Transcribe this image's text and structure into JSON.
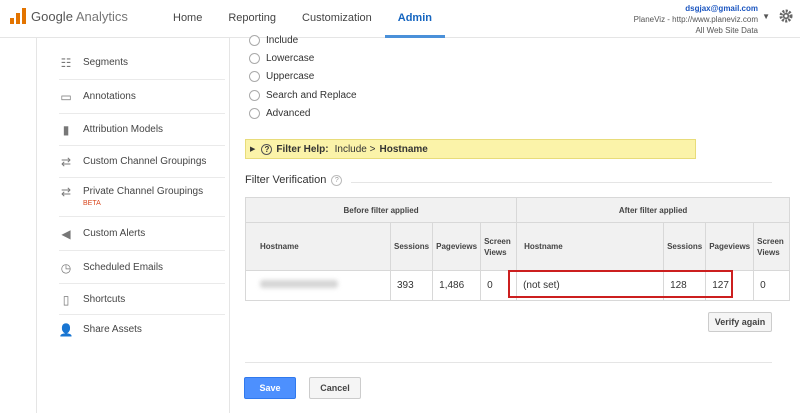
{
  "header": {
    "logo_google": "Google",
    "logo_analytics": "Analytics",
    "nav": [
      "Home",
      "Reporting",
      "Customization",
      "Admin"
    ],
    "active_nav": "Admin",
    "account_email": "dsgjax@gmail.com",
    "account_property": "PlaneViz - http://www.planeviz.com",
    "account_view": "All Web Site Data"
  },
  "sidebar": {
    "items": [
      {
        "label": "Segments",
        "icon": "segments-icon"
      },
      {
        "label": "Annotations",
        "icon": "annotations-icon"
      },
      {
        "label": "Attribution Models",
        "icon": "bar-chart-icon"
      },
      {
        "label": "Custom Channel Groupings",
        "icon": "channel-groupings-icon"
      },
      {
        "label": "Private Channel Groupings",
        "icon": "private-channel-groupings-icon",
        "badge": "BETA"
      },
      {
        "label": "Custom Alerts",
        "icon": "megaphone-icon"
      },
      {
        "label": "Scheduled Emails",
        "icon": "clock-icon"
      },
      {
        "label": "Shortcuts",
        "icon": "document-icon"
      },
      {
        "label": "Share Assets",
        "icon": "add-user-icon"
      }
    ]
  },
  "filter_options": [
    "Include",
    "Lowercase",
    "Uppercase",
    "Search and Replace",
    "Advanced"
  ],
  "filter_help": {
    "label": "Filter Help:",
    "type": "Include >",
    "field": "Hostname"
  },
  "verification": {
    "title": "Filter Verification",
    "before_label": "Before filter applied",
    "after_label": "After filter applied",
    "columns": [
      "Hostname",
      "Sessions",
      "Pageviews",
      "Screen Views"
    ],
    "before_row": {
      "hostname": "",
      "sessions": "393",
      "pageviews": "1,486",
      "screen_views": "0"
    },
    "after_row": {
      "hostname": "(not set)",
      "sessions": "128",
      "pageviews": "127",
      "screen_views": "0"
    },
    "verify_button": "Verify again"
  },
  "actions": {
    "save": "Save",
    "cancel": "Cancel"
  },
  "colors": {
    "accent_blue": "#4d90fe",
    "help_yellow": "#fbf3a9",
    "highlight_red": "#cc1f1f"
  }
}
